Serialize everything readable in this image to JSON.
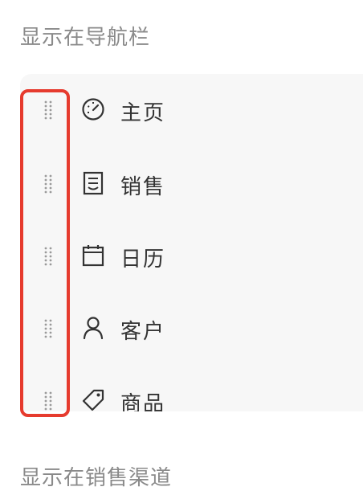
{
  "sections": {
    "nav_title": "显示在导航栏",
    "channel_title": "显示在销售渠道"
  },
  "nav_items": [
    {
      "label": "主页",
      "icon": "speedometer-icon"
    },
    {
      "label": "销售",
      "icon": "receipt-icon"
    },
    {
      "label": "日历",
      "icon": "calendar-icon"
    },
    {
      "label": "客户",
      "icon": "person-icon"
    },
    {
      "label": "商品",
      "icon": "tag-icon"
    }
  ],
  "colors": {
    "highlight": "#e63b2e",
    "text": "#333333",
    "muted": "#8a8a8a",
    "panel": "#f7f7f7"
  }
}
